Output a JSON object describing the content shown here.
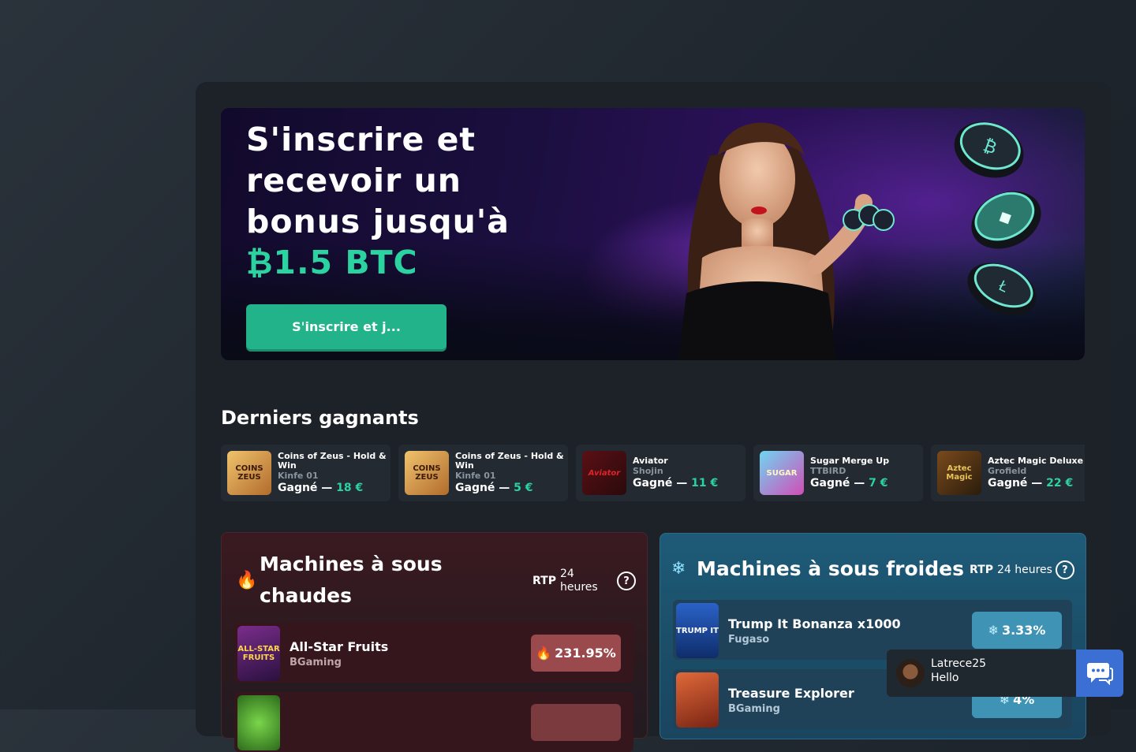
{
  "hero": {
    "title": "S'inscrire et recevoir un bonus jusqu'à",
    "currency_symbol": "₿",
    "amount": "1.5 BTC",
    "cta_label": "S'inscrire et j..."
  },
  "winners": {
    "title": "Derniers gagnants",
    "won_label": "Gagné —",
    "items": [
      {
        "game": "Coins of Zeus - Hold & Win",
        "user": "Kinfe 01",
        "amount": "18 €",
        "thumb_text": "COINS ZEUS"
      },
      {
        "game": "Coins of Zeus - Hold & Win",
        "user": "Kinfe 01",
        "amount": "5 €",
        "thumb_text": "COINS ZEUS"
      },
      {
        "game": "Aviator",
        "user": "Shojin",
        "amount": "11 €",
        "thumb_text": "Aviator"
      },
      {
        "game": "Sugar Merge Up",
        "user": "TTBIRD",
        "amount": "7 €",
        "thumb_text": "SUGAR"
      },
      {
        "game": "Aztec Magic Deluxe",
        "user": "Grofield",
        "amount": "22 €",
        "thumb_text": "Aztec Magic"
      }
    ]
  },
  "hot": {
    "title": "Machines à sous chaudes",
    "rtp_label": "RTP",
    "rtp_period": "24 heures",
    "help": "?",
    "items": [
      {
        "name": "All-Star Fruits",
        "provider": "BGaming",
        "rtp": "231.95%",
        "thumb_text": "ALL-STAR FRUITS"
      }
    ]
  },
  "cold": {
    "title": "Machines à sous froides",
    "rtp_label": "RTP",
    "rtp_period": "24 heures",
    "help": "?",
    "items": [
      {
        "name": "Trump It Bonanza x1000",
        "provider": "Fugaso",
        "rtp": "3.33%",
        "thumb_text": "TRUMP IT"
      },
      {
        "name": "Treasure Explorer",
        "provider": "BGaming",
        "rtp": "4%",
        "thumb_text": ""
      }
    ]
  },
  "chat": {
    "user": "Latrece25",
    "message": "Hello"
  },
  "colors": {
    "accent_green": "#2bd3a0",
    "button_green": "#23b38b",
    "hot_pill": "#9a4a4d",
    "cold_pill": "#3f94b6",
    "chat_blue": "#3b6fd3"
  }
}
